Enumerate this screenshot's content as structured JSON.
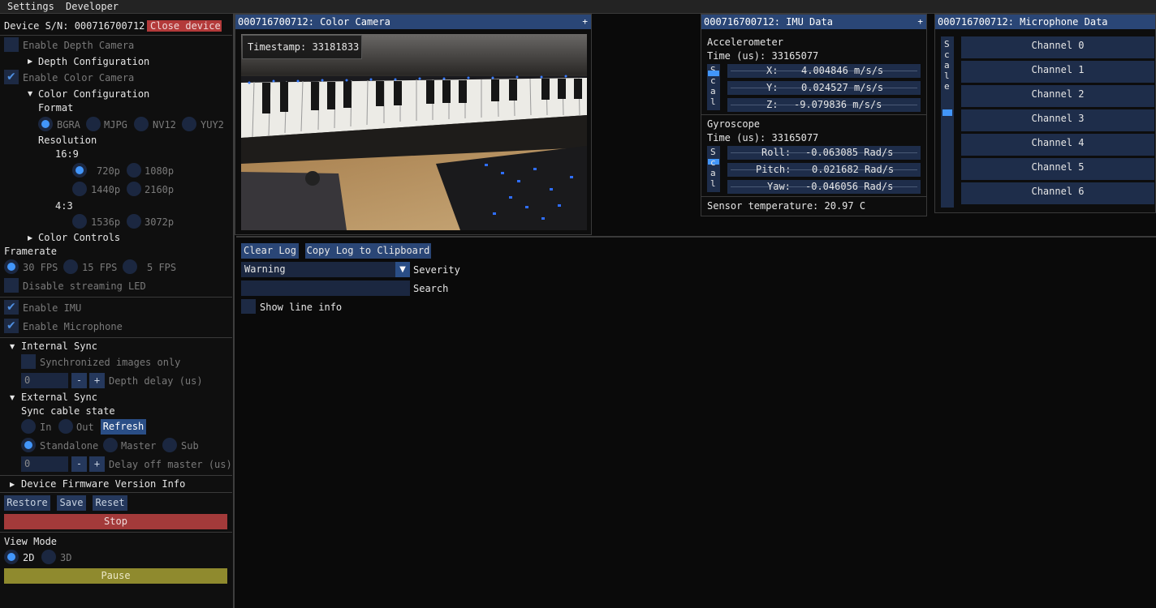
{
  "menubar": {
    "items": [
      "Settings",
      "Developer"
    ]
  },
  "device": {
    "serial_label": "Device S/N: 000716700712",
    "close_label": "Close device"
  },
  "depth": {
    "enable_label": "Enable Depth Camera",
    "config_label": "Depth Configuration"
  },
  "color": {
    "enable_label": "Enable Color Camera",
    "config_label": "Color Configuration",
    "format_label": "Format",
    "formats": [
      "BGRA",
      "MJPG",
      "NV12",
      "YUY2"
    ],
    "resolution_label": "Resolution",
    "ratio_16_9": "16:9",
    "res_16_9": [
      "720p",
      "1080p",
      "1440p",
      "2160p"
    ],
    "ratio_4_3": "4:3",
    "res_4_3": [
      "1536p",
      "3072p"
    ],
    "controls_label": "Color Controls"
  },
  "framerate": {
    "label": "Framerate",
    "options": [
      "30 FPS",
      "15 FPS",
      "5 FPS"
    ]
  },
  "led_label": "Disable streaming LED",
  "imu_enable_label": "Enable IMU",
  "mic_enable_label": "Enable Microphone",
  "internal_sync": {
    "label": "Internal Sync",
    "sync_only_label": "Synchronized images only",
    "depth_delay_value": "0",
    "depth_delay_label": "Depth delay (us)"
  },
  "external_sync": {
    "label": "External Sync",
    "cable_state_label": "Sync cable state",
    "in_label": "In",
    "out_label": "Out",
    "refresh_label": "Refresh",
    "modes": [
      "Standalone",
      "Master",
      "Sub"
    ],
    "delay_value": "0",
    "delay_label": "Delay off master (us)"
  },
  "stepper": {
    "minus": "-",
    "plus": "+"
  },
  "firmware_label": "Device Firmware Version Info",
  "actions": {
    "restore": "Restore",
    "save": "Save",
    "reset": "Reset",
    "stop": "Stop"
  },
  "view_mode": {
    "label": "View Mode",
    "options": [
      "2D",
      "3D"
    ],
    "pause": "Pause"
  },
  "camera_window": {
    "title": "000716700712: Color Camera",
    "timestamp": "Timestamp: 33181833"
  },
  "imu_window": {
    "title": "000716700712: IMU Data",
    "accel_label": "Accelerometer",
    "accel_time": "Time (us): 33165077",
    "accel": [
      {
        "axis": "X:",
        "value": "4.004846 m/s/s"
      },
      {
        "axis": "Y:",
        "value": "0.024527 m/s/s"
      },
      {
        "axis": "Z:",
        "value": "-9.079836 m/s/s"
      }
    ],
    "gyro_label": "Gyroscope",
    "gyro_time": "Time (us): 33165077",
    "gyro": [
      {
        "axis": "Roll:",
        "value": "-0.063085 Rad/s"
      },
      {
        "axis": "Pitch:",
        "value": "0.021682 Rad/s"
      },
      {
        "axis": "Yaw:",
        "value": "-0.046056 Rad/s"
      }
    ],
    "scale_letters": [
      "S",
      "c",
      "a",
      "l"
    ],
    "temperature": "Sensor temperature: 20.97 C"
  },
  "mic_window": {
    "title": "000716700712: Microphone Data",
    "scale_letters": [
      "S",
      "c",
      "a",
      "l",
      "e"
    ],
    "channels": [
      "Channel 0",
      "Channel 1",
      "Channel 2",
      "Channel 3",
      "Channel 4",
      "Channel 5",
      "Channel 6"
    ]
  },
  "window_plus": "+",
  "log": {
    "clear_label": "Clear Log",
    "copy_label": "Copy Log to Clipboard",
    "severity_value": "Warning",
    "severity_label": "Severity",
    "search_value": "",
    "search_label": "Search",
    "line_info_label": "Show line info"
  },
  "colors": {
    "accent": "#4296fa",
    "title_bar": "#2a4676",
    "stop": "#a33a3a",
    "pause": "#8f8a2e",
    "close": "#b33a3a"
  }
}
